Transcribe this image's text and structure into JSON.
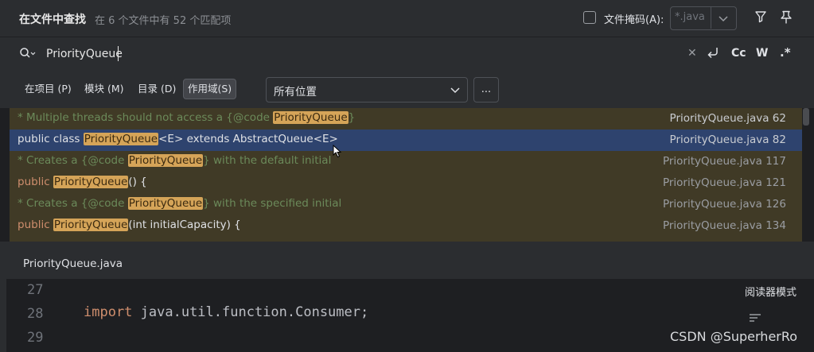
{
  "header": {
    "title": "在文件中查找",
    "match_summary": "在 6 个文件中有 52 个匹配项",
    "file_mask_label": "文件掩码(A):",
    "file_mask_value": "*.java",
    "file_mask_checked": false
  },
  "search": {
    "query": "PriorityQueue"
  },
  "scope_tabs": [
    {
      "label": "在项目 (P)"
    },
    {
      "label": "模块 (M)"
    },
    {
      "label": "目录 (D)"
    },
    {
      "label": "作用域(S)",
      "active": true
    }
  ],
  "location": {
    "value": "所有位置",
    "more_label": "..."
  },
  "results": [
    {
      "pre": "* Multiple threads should not access a {@code ",
      "match": "PriorityQueue",
      "post": "}",
      "file": "PriorityQueue.java 62"
    },
    {
      "pre": "public class ",
      "match": "PriorityQueue",
      "post": "<E> extends AbstractQueue<E>",
      "file": "PriorityQueue.java 82",
      "selected": true
    },
    {
      "pre": "* Creates a {@code ",
      "match": "PriorityQueue",
      "post": "} with the default initial",
      "file": "PriorityQueue.java 117"
    },
    {
      "pre": "public ",
      "match": "PriorityQueue",
      "post": "() {",
      "file": "PriorityQueue.java 121"
    },
    {
      "pre": "* Creates a {@code ",
      "match": "PriorityQueue",
      "post": "} with the specified initial",
      "file": "PriorityQueue.java 126"
    },
    {
      "pre": "public ",
      "match": "PriorityQueue",
      "post": "(int initialCapacity) {",
      "file": "PriorityQueue.java 134"
    }
  ],
  "preview": {
    "file_name": "PriorityQueue.java",
    "line_numbers": [
      "27",
      "28",
      "29"
    ],
    "code_keyword": "import",
    "code_rest": " java.util.function.Consumer;",
    "reader_mode_label": "阅读器模式"
  },
  "watermark": "CSDN @SuperherRo",
  "colors": {
    "match_highlight": "#d5a458",
    "selected_row": "#2e436e",
    "results_background": "#403a26",
    "keyword": "#cf8e6d",
    "comment": "#6b8a5a"
  }
}
